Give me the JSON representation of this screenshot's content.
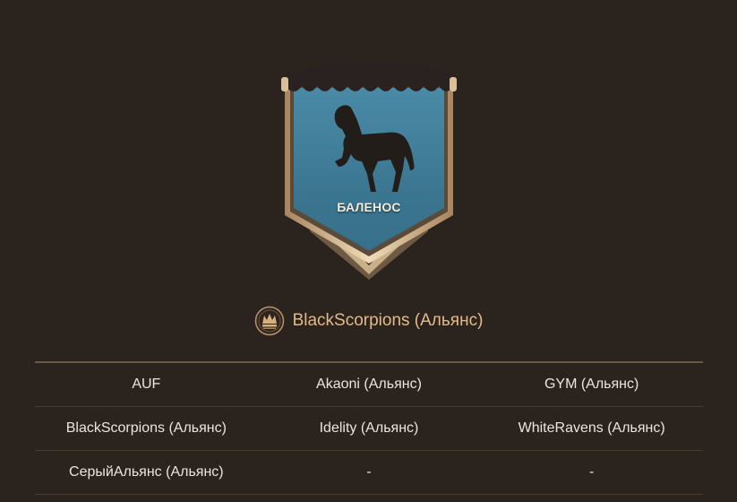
{
  "banner": {
    "title": "БАЛЕНОС",
    "emblem_icon": "horse-icon",
    "colors": {
      "field": "#3f7a95",
      "trim": "#d8c09a",
      "top": "#2a2220"
    }
  },
  "winner": {
    "icon": "crown-emblem-icon",
    "name": "BlackScorpions (Альянс)",
    "color": "#e3b98a"
  },
  "alliances": {
    "rows": [
      [
        "AUF",
        "Akaoni (Альянс)",
        "GYM (Альянс)"
      ],
      [
        "BlackScorpions (Альянс)",
        "Idelity (Альянс)",
        "WhiteRavens (Альянс)"
      ],
      [
        "СерыйАльянс (Альянс)",
        "-",
        "-"
      ]
    ]
  }
}
